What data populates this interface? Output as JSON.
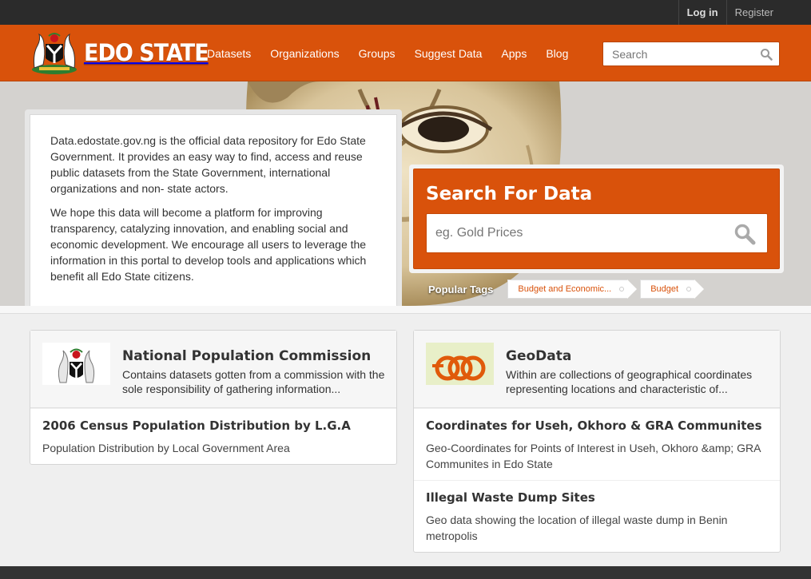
{
  "account": {
    "login": "Log in",
    "register": "Register"
  },
  "site": {
    "name": "EDO STATE"
  },
  "nav": {
    "items": [
      "Datasets",
      "Organizations",
      "Groups",
      "Suggest Data",
      "Apps",
      "Blog"
    ]
  },
  "header_search": {
    "placeholder": "Search"
  },
  "intro": {
    "paragraph1": "Data.edostate.gov.ng is the official data repository for Edo State Government. It provides an easy way to find, access and reuse public datasets from the State Government, international organizations and non- state actors.",
    "paragraph2": "We hope this data will become a platform for improving transparency, catalyzing innovation, and enabling social and economic development. We encourage all users to leverage the information in this portal to develop tools and applications which benefit all Edo State citizens."
  },
  "search_box": {
    "title": "Search For Data",
    "placeholder": "eg. Gold Prices"
  },
  "popular_tags": {
    "label": "Popular Tags",
    "tags": [
      "Budget and Economic...",
      "Budget"
    ]
  },
  "organizations": [
    {
      "title": "National Population Commission",
      "description": "Contains datasets gotten from a commission with the sole responsibility of gathering information...",
      "datasets": [
        {
          "title": "2006 Census Population Distribution by L.G.A",
          "description": "Population Distribution by Local Government Area"
        }
      ]
    },
    {
      "title": "GeoData",
      "description": "Within are collections of geographical coordinates representing locations and characteristic of...",
      "datasets": [
        {
          "title": "Coordinates for Useh, Okhoro & GRA Communites",
          "description": "Geo-Coordinates for Points of Interest in Useh, Okhoro &amp; GRA Communites in Edo State"
        },
        {
          "title": "Illegal Waste Dump Sites",
          "description": "Geo data showing the location of illegal waste dump in Benin metropolis"
        }
      ]
    }
  ],
  "colors": {
    "brand_orange": "#d9520b",
    "account_bar": "#2b2b2b",
    "footer": "#333333"
  }
}
